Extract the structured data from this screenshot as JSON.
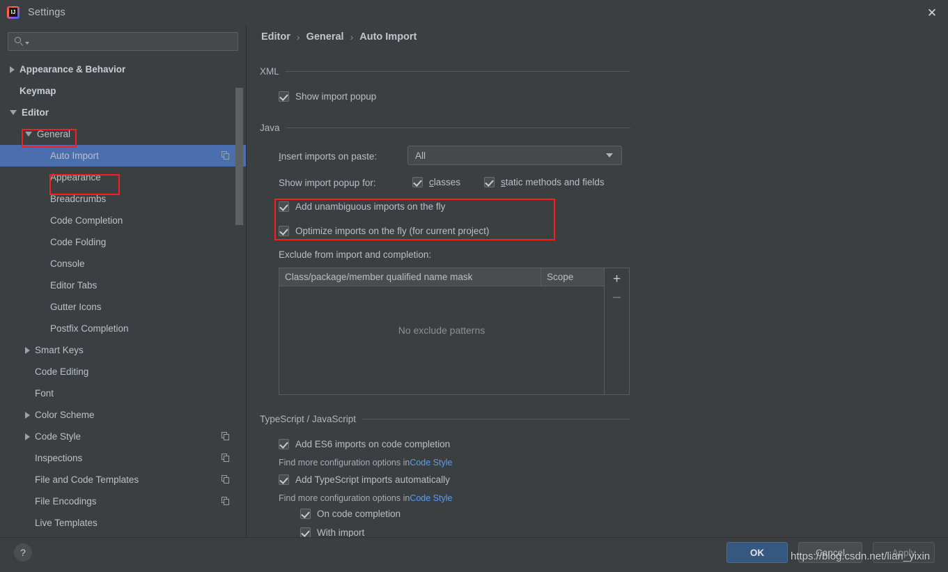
{
  "window": {
    "title": "Settings",
    "close_label": "✕",
    "logo_name": "intellij-idea-logo"
  },
  "search": {
    "value": "",
    "placeholder": ""
  },
  "sidebar": {
    "items": [
      {
        "label": "Appearance & Behavior",
        "level": 0,
        "arrow": "collapsed",
        "bold": true,
        "selected": false,
        "copy": false
      },
      {
        "label": "Keymap",
        "level": 0,
        "arrow": "none",
        "bold": true,
        "selected": false,
        "copy": false
      },
      {
        "label": "Editor",
        "level": 0,
        "arrow": "expanded",
        "bold": true,
        "selected": false,
        "copy": false
      },
      {
        "label": "General",
        "level": 1,
        "arrow": "expanded",
        "bold": false,
        "selected": false,
        "copy": false
      },
      {
        "label": "Auto Import",
        "level": 2,
        "arrow": "none",
        "bold": false,
        "selected": true,
        "copy": true
      },
      {
        "label": "Appearance",
        "level": 2,
        "arrow": "none",
        "bold": false,
        "selected": false,
        "copy": false
      },
      {
        "label": "Breadcrumbs",
        "level": 2,
        "arrow": "none",
        "bold": false,
        "selected": false,
        "copy": false
      },
      {
        "label": "Code Completion",
        "level": 2,
        "arrow": "none",
        "bold": false,
        "selected": false,
        "copy": false
      },
      {
        "label": "Code Folding",
        "level": 2,
        "arrow": "none",
        "bold": false,
        "selected": false,
        "copy": false
      },
      {
        "label": "Console",
        "level": 2,
        "arrow": "none",
        "bold": false,
        "selected": false,
        "copy": false
      },
      {
        "label": "Editor Tabs",
        "level": 2,
        "arrow": "none",
        "bold": false,
        "selected": false,
        "copy": false
      },
      {
        "label": "Gutter Icons",
        "level": 2,
        "arrow": "none",
        "bold": false,
        "selected": false,
        "copy": false
      },
      {
        "label": "Postfix Completion",
        "level": 2,
        "arrow": "none",
        "bold": false,
        "selected": false,
        "copy": false
      },
      {
        "label": "Smart Keys",
        "level": 1,
        "arrow": "collapsed",
        "bold": false,
        "selected": false,
        "copy": false
      },
      {
        "label": "Code Editing",
        "level": 1,
        "arrow": "none",
        "bold": false,
        "selected": false,
        "copy": false
      },
      {
        "label": "Font",
        "level": 1,
        "arrow": "none",
        "bold": false,
        "selected": false,
        "copy": false
      },
      {
        "label": "Color Scheme",
        "level": 1,
        "arrow": "collapsed",
        "bold": false,
        "selected": false,
        "copy": false
      },
      {
        "label": "Code Style",
        "level": 1,
        "arrow": "collapsed",
        "bold": false,
        "selected": false,
        "copy": true
      },
      {
        "label": "Inspections",
        "level": 1,
        "arrow": "none",
        "bold": false,
        "selected": false,
        "copy": true
      },
      {
        "label": "File and Code Templates",
        "level": 1,
        "arrow": "none",
        "bold": false,
        "selected": false,
        "copy": true
      },
      {
        "label": "File Encodings",
        "level": 1,
        "arrow": "none",
        "bold": false,
        "selected": false,
        "copy": true
      },
      {
        "label": "Live Templates",
        "level": 1,
        "arrow": "none",
        "bold": false,
        "selected": false,
        "copy": false
      }
    ]
  },
  "breadcrumb": {
    "part1": "Editor",
    "sep1": "›",
    "part2": "General",
    "sep2": "›",
    "part3": "Auto Import"
  },
  "xml": {
    "group_title": "XML",
    "show_import_popup": "Show import popup"
  },
  "java": {
    "group_title": "Java",
    "insert_imports_label": "Insert imports on paste:",
    "insert_imports_value": "All",
    "show_import_popup_for_label": "Show import popup for:",
    "classes": "classes",
    "static_methods": "static methods and fields",
    "add_unambiguous": "Add unambiguous imports on the fly",
    "optimize_imports": "Optimize imports on the fly (for current project)",
    "exclude_label": "Exclude from import and completion:",
    "table": {
      "columns": [
        "Class/package/member qualified name mask",
        "Scope"
      ],
      "rows": [],
      "empty_text": "No exclude patterns",
      "add_button": "+",
      "remove_button": "–"
    }
  },
  "typescript": {
    "group_title": "TypeScript / JavaScript",
    "add_es6": "Add ES6 imports on code completion",
    "hint_prefix_1": "Find more configuration options in ",
    "hint_link_1": "Code Style",
    "add_ts_auto": "Add TypeScript imports automatically",
    "hint_prefix_2": "Find more configuration options in ",
    "hint_link_2": "Code Style",
    "on_code_completion": "On code completion",
    "with_import": "With import"
  },
  "footer": {
    "help": "?",
    "ok": "OK",
    "cancel": "Cancel",
    "apply": "Apply"
  },
  "watermark": {
    "text": "https://blog.csdn.net/lian_yixin"
  },
  "colors": {
    "window_bg": "#3c3f41",
    "selection_blue": "#4b6eaf",
    "accent_link": "#589df6",
    "annotation_red": "#fb1c1c",
    "ok_button": "#365880"
  }
}
